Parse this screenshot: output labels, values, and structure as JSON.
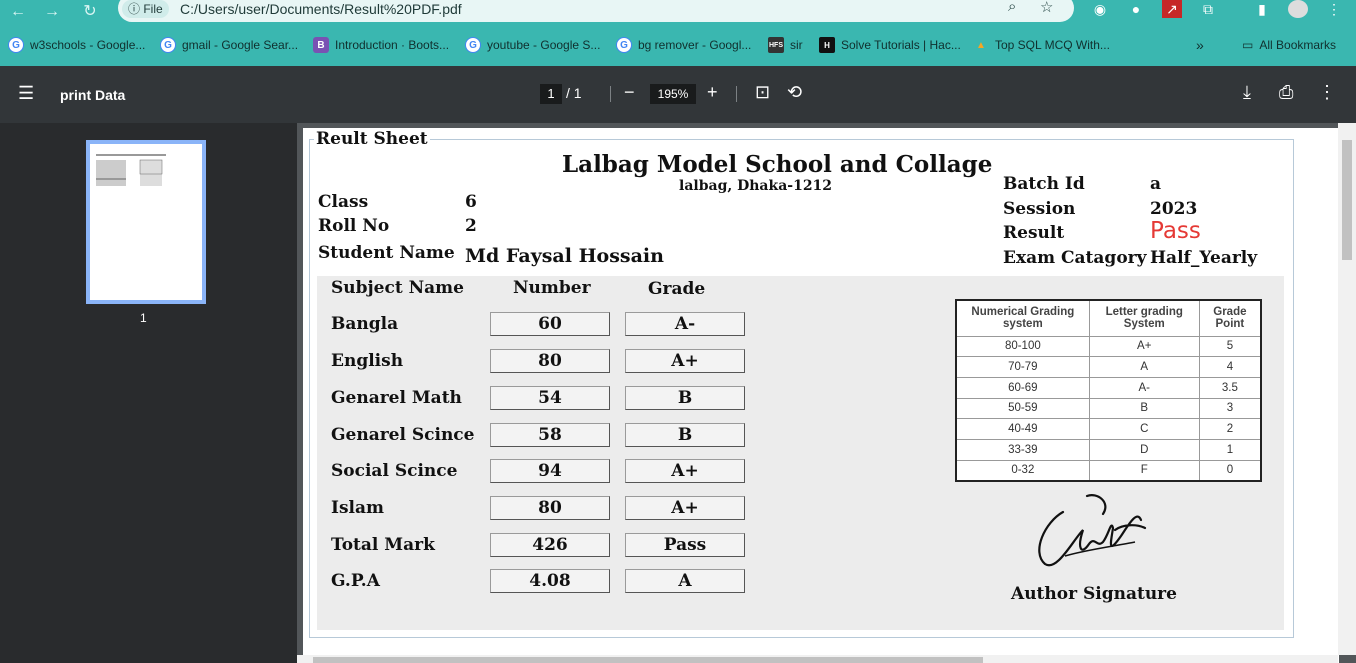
{
  "browser": {
    "file_chip": "File",
    "url": "C:/Users/user/Documents/Result%20PDF.pdf",
    "bookmarks": [
      {
        "label": "w3schools - Google...",
        "icon": "google-icon",
        "color": "#4285f4"
      },
      {
        "label": "gmail - Google Sear...",
        "icon": "google-icon",
        "color": "#4285f4"
      },
      {
        "label": "Introduction · Boots...",
        "icon": "bootstrap-icon",
        "color": "#7952b3"
      },
      {
        "label": "youtube - Google S...",
        "icon": "google-icon",
        "color": "#4285f4"
      },
      {
        "label": "bg remover - Googl...",
        "icon": "google-icon",
        "color": "#4285f4"
      },
      {
        "label": "sir",
        "icon": "hfs-icon",
        "color": "#333333"
      },
      {
        "label": "Solve Tutorials | Hac...",
        "icon": "hackerrank-icon",
        "color": "#111111"
      },
      {
        "label": "Top SQL MCQ With...",
        "icon": "mountain-icon",
        "color": "#f5a623"
      }
    ],
    "all_bookmarks": "All Bookmarks"
  },
  "pdf": {
    "title": "print Data",
    "page_current": "1",
    "page_total": "/ 1",
    "zoom": "195%",
    "thumb_number": "1"
  },
  "sheet": {
    "legend": "Reult Sheet",
    "school": "Lalbag Model School and Collage",
    "address": "lalbag, Dhaka-1212",
    "info_left": [
      {
        "label": "Class",
        "value": "6"
      },
      {
        "label": "Roll No",
        "value": "2"
      },
      {
        "label": "Student Name",
        "value": "Md Faysal Hossain"
      }
    ],
    "info_right": [
      {
        "label": "Batch Id",
        "value": "a"
      },
      {
        "label": "Session",
        "value": "2023"
      },
      {
        "label": "Result",
        "value": "Pass"
      },
      {
        "label": "Exam Catagory",
        "value": "Half_Yearly"
      }
    ],
    "result_color": "#e53935",
    "headers": {
      "subject": "Subject Name",
      "number": "Number",
      "grade": "Grade"
    },
    "rows": [
      {
        "subject": "Bangla",
        "number": "60",
        "grade": "A-"
      },
      {
        "subject": "English",
        "number": "80",
        "grade": "A+"
      },
      {
        "subject": "Genarel Math",
        "number": "54",
        "grade": "B"
      },
      {
        "subject": "Genarel Scince",
        "number": "58",
        "grade": "B"
      },
      {
        "subject": "Social Scince",
        "number": "94",
        "grade": "A+"
      },
      {
        "subject": "Islam",
        "number": "80",
        "grade": "A+"
      },
      {
        "subject": "Total Mark",
        "number": "426",
        "grade": "Pass"
      },
      {
        "subject": "G.P.A",
        "number": "4.08",
        "grade": "A"
      }
    ],
    "grading_headers": [
      "Numerical Grading system",
      "Letter grading System",
      "Grade Point"
    ],
    "grading_rows": [
      [
        "80-100",
        "A+",
        "5"
      ],
      [
        "70-79",
        "A",
        "4"
      ],
      [
        "60-69",
        "A-",
        "3.5"
      ],
      [
        "50-59",
        "B",
        "3"
      ],
      [
        "40-49",
        "C",
        "2"
      ],
      [
        "33-39",
        "D",
        "1"
      ],
      [
        "0-32",
        "F",
        "0"
      ]
    ],
    "signature_label": "Author Signature"
  }
}
